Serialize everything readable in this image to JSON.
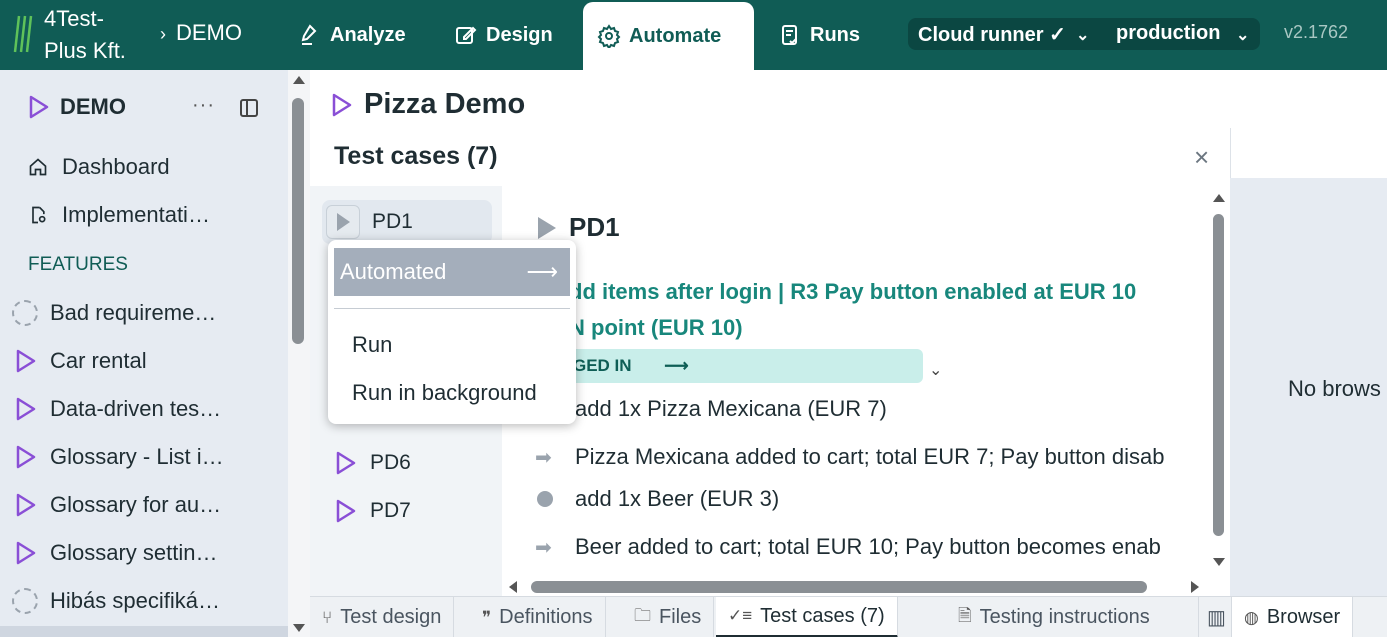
{
  "app": {
    "logo_text": "4Test-\nPlus Kft.",
    "breadcrumb": "DEMO",
    "version": "v2.1762"
  },
  "nav": {
    "tabs": [
      {
        "label": "Analyze",
        "icon": "analyze-icon"
      },
      {
        "label": "Design",
        "icon": "design-icon"
      },
      {
        "label": "Automate",
        "icon": "gear-icon",
        "active": true
      },
      {
        "label": "Runs",
        "icon": "runs-icon"
      }
    ],
    "runner": "Cloud runner ✓",
    "environment": "production"
  },
  "sidebar": {
    "project": "DEMO",
    "more": "···",
    "items": [
      {
        "label": "Dashboard",
        "icon": "home-icon"
      },
      {
        "label": "Implementati…",
        "icon": "document-gear-icon"
      }
    ],
    "section": "FEATURES",
    "features": [
      {
        "label": "Bad requireme…",
        "icon": "dashed-circle-icon"
      },
      {
        "label": "Car rental",
        "icon": "play-icon"
      },
      {
        "label": "Data-driven tes…",
        "icon": "play-icon"
      },
      {
        "label": "Glossary - List i…",
        "icon": "play-icon"
      },
      {
        "label": "Glossary for au…",
        "icon": "play-icon"
      },
      {
        "label": "Glossary settin…",
        "icon": "play-icon"
      },
      {
        "label": "Hibás specifiká…",
        "icon": "dashed-circle-icon"
      }
    ]
  },
  "main": {
    "title": "Pizza Demo",
    "panel_title": "Test cases (7)",
    "close": "×",
    "test_cases": [
      "PD1",
      "PD6",
      "PD7"
    ],
    "detail": {
      "title": "PD1",
      "rule_line1": "dd items after login | R3 Pay button enabled at EUR 10",
      "rule_line2": "N point (EUR 10)",
      "tag": "GED IN",
      "tag_arrow": "⟶",
      "steps": [
        {
          "kind": "none",
          "text": "add 1x Pizza Mexicana (EUR 7)"
        },
        {
          "kind": "arrow",
          "text": "Pizza Mexicana added to cart; total EUR 7; Pay button disab"
        },
        {
          "kind": "dot",
          "text": "add 1x Beer (EUR 3)"
        },
        {
          "kind": "arrow",
          "text": "Beer added to cart; total EUR 10; Pay button becomes enab"
        }
      ]
    },
    "browser_message": "No brows"
  },
  "menu": {
    "automated": "Automated",
    "automated_arrow": "⟶",
    "run": "Run",
    "run_background": "Run in background"
  },
  "bottom_tabs": [
    {
      "label": "Test design",
      "icon": "branch-icon"
    },
    {
      "label": "Definitions",
      "icon": "quote-icon"
    },
    {
      "label": "Files",
      "icon": "folder-icon"
    },
    {
      "label": "Test cases (7)",
      "icon": "checklist-icon",
      "active": true
    },
    {
      "label": "Testing instructions",
      "icon": "document-gear-icon"
    },
    {
      "label": "Browser",
      "icon": "globe-icon"
    }
  ],
  "colors": {
    "brand": "#105c55",
    "accent_text": "#18877c",
    "play_purple": "#8a4fd6"
  }
}
